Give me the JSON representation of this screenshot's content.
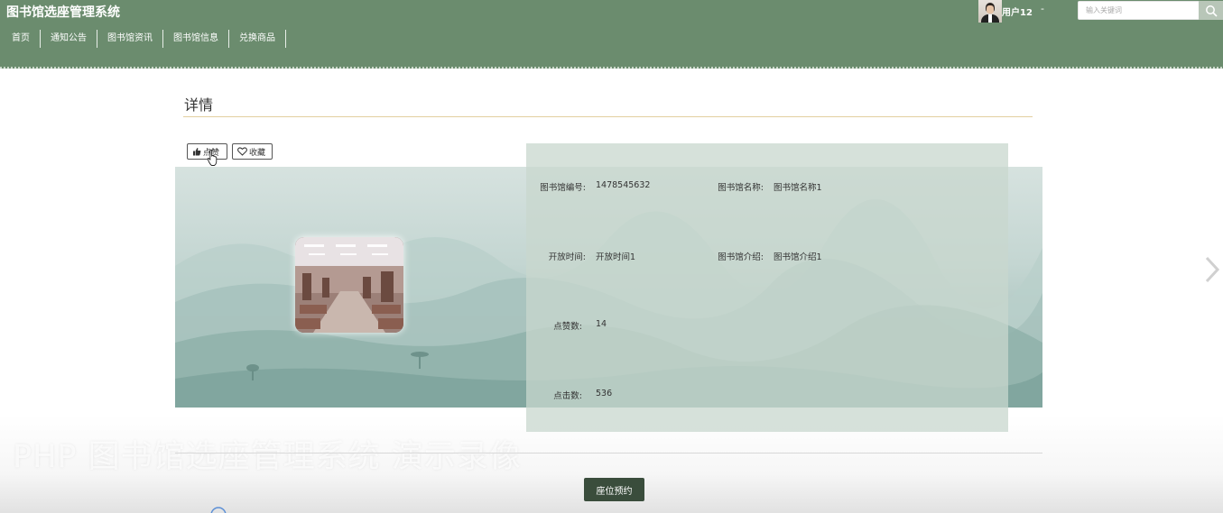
{
  "header": {
    "site_title": "图书馆选座管理系统",
    "username": "用户12",
    "user_menu_caret": "-",
    "search": {
      "placeholder": "输入关键词"
    }
  },
  "nav": {
    "items": [
      {
        "label": "首页"
      },
      {
        "label": "通知公告"
      },
      {
        "label": "图书馆资讯"
      },
      {
        "label": "图书馆信息"
      },
      {
        "label": "兑换商品"
      }
    ]
  },
  "detail": {
    "title": "详情",
    "like_label": "点赞",
    "favorite_label": "收藏",
    "fields": [
      {
        "label": "图书馆编号:",
        "value": "1478545632"
      },
      {
        "label": "图书馆名称:",
        "value": "图书馆名称1"
      },
      {
        "label": "开放时间:",
        "value": "开放时间1"
      },
      {
        "label": "图书馆介绍:",
        "value": "图书馆介绍1"
      },
      {
        "label": "点赞数:",
        "value": "14"
      },
      {
        "label": "点击数:",
        "value": "536"
      }
    ],
    "reserve_button": "座位预约"
  },
  "overlay": {
    "watermark": "PHP 图书馆选座管理系统 演示录像"
  },
  "colors": {
    "header_bg": "#6b8c6e",
    "title_underline": "#e3cfa0",
    "reserve_button_bg": "#3a4d3c"
  },
  "icons": [
    "search-icon",
    "thumbs-up-icon",
    "heart-icon",
    "chevron-right-icon",
    "avatar"
  ]
}
